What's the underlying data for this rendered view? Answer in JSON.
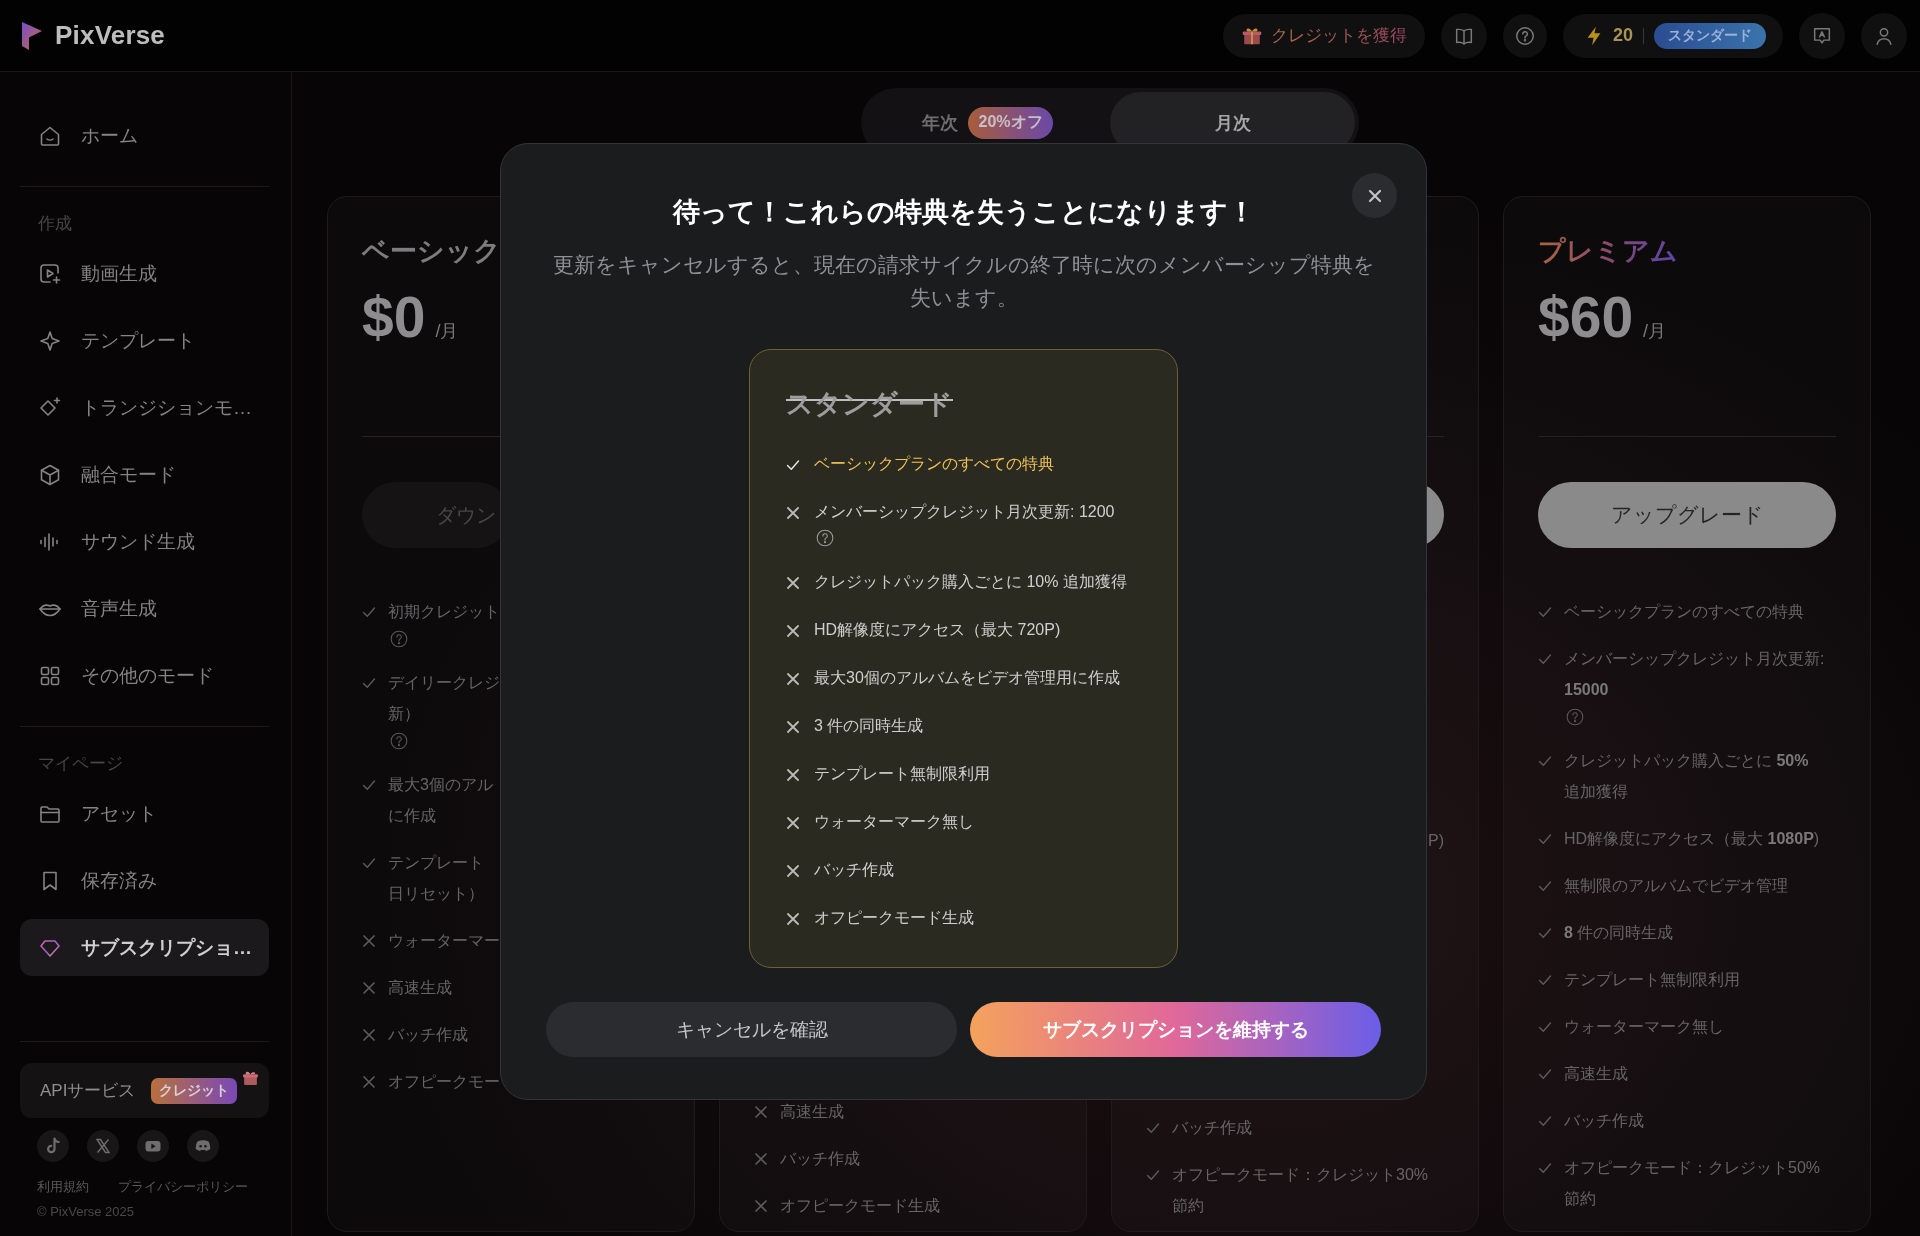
{
  "header": {
    "logo": "PixVerse",
    "earn_credits": "クレジットを獲得",
    "credits": "20",
    "plan": "スタンダード"
  },
  "sidebar": {
    "sections": [
      {
        "items": [
          {
            "label": "ホーム",
            "selected": false
          }
        ]
      },
      {
        "heading": "作成",
        "items": [
          {
            "label": "動画生成",
            "selected": false
          },
          {
            "label": "テンプレート",
            "selected": false
          },
          {
            "label": "トランジションモ…",
            "selected": false
          },
          {
            "label": "融合モード",
            "selected": false
          },
          {
            "label": "サウンド生成",
            "selected": false
          },
          {
            "label": "音声生成",
            "selected": false
          },
          {
            "label": "その他のモード",
            "selected": false
          }
        ]
      },
      {
        "heading": "マイページ",
        "items": [
          {
            "label": "アセット",
            "selected": false
          },
          {
            "label": "保存済み",
            "selected": false
          },
          {
            "label": "サブスクリプショ…",
            "selected": true
          }
        ]
      }
    ],
    "api": {
      "label": "APIサービス",
      "badge": "クレジット"
    },
    "links": [
      "利用規約",
      "プライバシーポリシー"
    ],
    "copyright": "© PixVerse 2025"
  },
  "billing_toggle": [
    {
      "label": "年次",
      "badge": "20%オフ",
      "selected": false
    },
    {
      "label": "月次",
      "selected": true
    }
  ],
  "plans": [
    {
      "title": "ベーシック",
      "featured": false,
      "price": "$0",
      "period": "/月",
      "button": {
        "kind": "dark",
        "label": "ダウン"
      },
      "features": [
        {
          "kind": "check",
          "lines": [
            "初期クレジット"
          ],
          "help": true
        },
        {
          "kind": "check",
          "lines": [
            "デイリークレジ",
            "新）"
          ],
          "help": true
        },
        {
          "kind": "check",
          "lines": [
            "最大3個のアル",
            "に作成"
          ],
          "help": false
        },
        {
          "kind": "check",
          "lines": [
            "テンプレート",
            "日リセット）"
          ],
          "help": false
        },
        {
          "kind": "cross",
          "lines": [
            "ウォーターマー"
          ],
          "help": false
        },
        {
          "kind": "cross",
          "lines": [
            "高速生成"
          ],
          "help": false
        },
        {
          "kind": "cross",
          "lines": [
            "バッチ作成"
          ],
          "help": false
        },
        {
          "kind": "cross",
          "lines": [
            "オフピークモー"
          ],
          "help": false
        }
      ]
    },
    {
      "features": [
        {
          "kind": "cross",
          "lines": [
            "高速生成"
          ],
          "help": false
        },
        {
          "kind": "cross",
          "lines": [
            "バッチ作成"
          ],
          "help": false
        },
        {
          "kind": "cross",
          "lines": [
            "オフピークモード生成"
          ],
          "help": false
        }
      ]
    },
    {
      "button": {
        "kind": "light"
      },
      "features": [
        {
          "kind": "fragment",
          "lines": [
            "P)"
          ],
          "help": false
        },
        {
          "kind": "check",
          "lines": [
            "バッチ作成"
          ],
          "help": false
        },
        {
          "kind": "check",
          "lines": [
            "オフピークモード：クレジット30%節約"
          ],
          "help": false
        }
      ]
    },
    {
      "title": "プレミアム",
      "featured": true,
      "price": "$60",
      "period": "/月",
      "button": {
        "kind": "light",
        "label": "アップグレード"
      },
      "features": [
        {
          "kind": "check",
          "lines": [
            "ベーシックプランのすべての特典"
          ],
          "help": false
        },
        {
          "kind": "check",
          "lines": [
            "メンバーシップクレジット月次更新: **15000**"
          ],
          "help": true
        },
        {
          "kind": "check",
          "lines": [
            "クレジットパック購入ごとに **50%** 追加獲得"
          ],
          "help": false
        },
        {
          "kind": "check",
          "lines": [
            "HD解像度にアクセス（最大 **1080P**)"
          ],
          "help": false
        },
        {
          "kind": "check",
          "lines": [
            "無制限のアルバムでビデオ管理"
          ],
          "help": false
        },
        {
          "kind": "check",
          "lines": [
            "**8** 件の同時生成"
          ],
          "help": false
        },
        {
          "kind": "check",
          "lines": [
            "テンプレート無制限利用"
          ],
          "help": false
        },
        {
          "kind": "check",
          "lines": [
            "ウォーターマーク無し"
          ],
          "help": false
        },
        {
          "kind": "check",
          "lines": [
            "高速生成"
          ],
          "help": false
        },
        {
          "kind": "check",
          "lines": [
            "バッチ作成"
          ],
          "help": false
        },
        {
          "kind": "check",
          "lines": [
            "オフピークモード：クレジット50%節約"
          ],
          "help": false
        }
      ]
    }
  ],
  "dialog": {
    "title": "待って！これらの特典を失うことになります！",
    "message": "更新をキャンセルすると、現在の請求サイクルの終了時に次のメンバーシップ特典を失います。",
    "plan_name": "スタンダード",
    "benefits": [
      {
        "kind": "kept",
        "text": "ベーシックプランのすべての特典",
        "help": false
      },
      {
        "kind": "lost",
        "text": "メンバーシップクレジット月次更新: 1200",
        "help": true
      },
      {
        "kind": "lost",
        "text": "クレジットパック購入ごとに 10% 追加獲得",
        "help": false
      },
      {
        "kind": "lost",
        "text": "HD解像度にアクセス（最大 720P)",
        "help": false
      },
      {
        "kind": "lost",
        "text": "最大30個のアルバムをビデオ管理用に作成",
        "help": false
      },
      {
        "kind": "lost",
        "text": "3 件の同時生成",
        "help": false
      },
      {
        "kind": "lost",
        "text": "テンプレート無制限利用",
        "help": false
      },
      {
        "kind": "lost",
        "text": "ウォーターマーク無し",
        "help": false
      },
      {
        "kind": "lost",
        "text": "バッチ作成",
        "help": false
      },
      {
        "kind": "lost",
        "text": "オフピークモード生成",
        "help": false
      }
    ],
    "buttons": [
      {
        "kind": "secondary",
        "label": "キャンセルを確認"
      },
      {
        "kind": "primary",
        "label": "サブスクリプションを維持する"
      }
    ]
  }
}
